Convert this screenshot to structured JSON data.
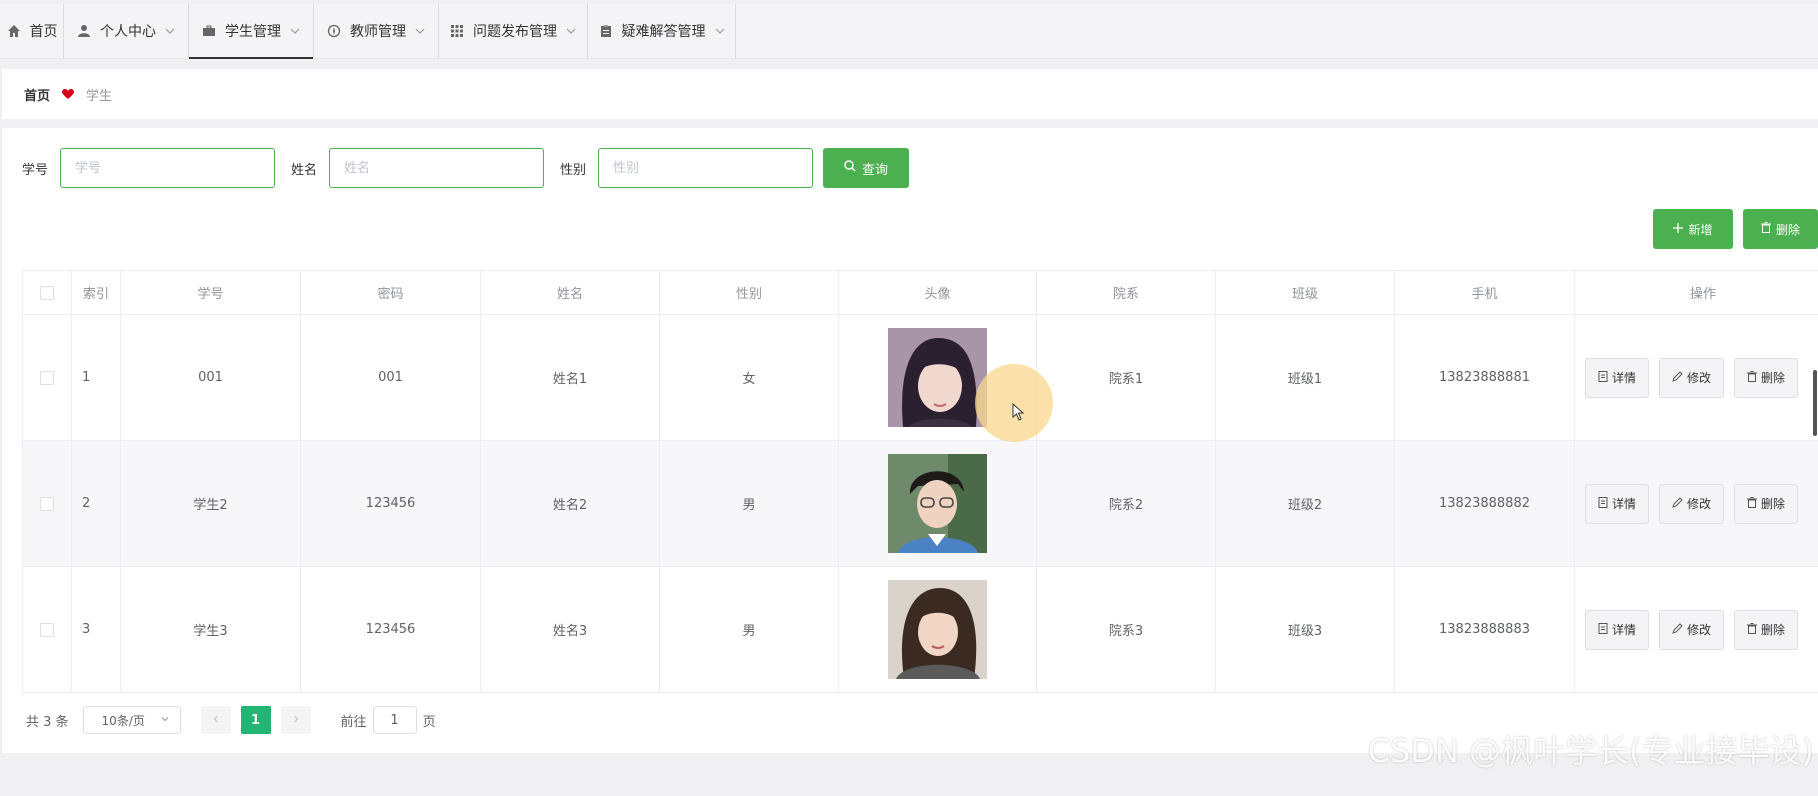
{
  "nav": {
    "items": [
      {
        "label": "首页",
        "icon": "home-icon",
        "dropdown": false
      },
      {
        "label": "个人中心",
        "icon": "user-icon",
        "dropdown": true
      },
      {
        "label": "学生管理",
        "icon": "briefcase-icon",
        "dropdown": true,
        "active": true
      },
      {
        "label": "教师管理",
        "icon": "compass-icon",
        "dropdown": true
      },
      {
        "label": "问题发布管理",
        "icon": "grid-icon",
        "dropdown": true
      },
      {
        "label": "疑难解答管理",
        "icon": "clipboard-icon",
        "dropdown": true
      }
    ]
  },
  "breadcrumb": {
    "home": "首页",
    "separator_icon": "heart-icon",
    "current": "学生"
  },
  "search": {
    "fields": [
      {
        "label": "学号",
        "placeholder": "学号",
        "value": ""
      },
      {
        "label": "姓名",
        "placeholder": "姓名",
        "value": ""
      },
      {
        "label": "性别",
        "placeholder": "性别",
        "value": ""
      }
    ],
    "query_label": "查询"
  },
  "actions": {
    "add_label": "新增",
    "delete_label": "删除"
  },
  "table": {
    "headers": [
      "索引",
      "学号",
      "密码",
      "姓名",
      "性别",
      "头像",
      "院系",
      "班级",
      "手机",
      "操作"
    ],
    "rows": [
      {
        "index": "1",
        "student_no": "001",
        "password": "001",
        "name": "姓名1",
        "gender": "女",
        "department": "院系1",
        "class": "班级1",
        "phone": "13823888881"
      },
      {
        "index": "2",
        "student_no": "学生2",
        "password": "123456",
        "name": "姓名2",
        "gender": "男",
        "department": "院系2",
        "class": "班级2",
        "phone": "13823888882"
      },
      {
        "index": "3",
        "student_no": "学生3",
        "password": "123456",
        "name": "姓名3",
        "gender": "男",
        "department": "院系3",
        "class": "班级3",
        "phone": "13823888883"
      }
    ],
    "row_actions": {
      "detail": "详情",
      "edit": "修改",
      "delete": "删除"
    }
  },
  "pagination": {
    "total_text": "共 3 条",
    "page_size": "10条/页",
    "current_page": "1",
    "goto_prefix": "前往",
    "goto_value": "1",
    "goto_suffix": "页"
  },
  "watermark": "CSDN @枫叶学长(专业接毕设)",
  "colors": {
    "primary_green": "#4caf50",
    "page_active": "#22b573"
  }
}
